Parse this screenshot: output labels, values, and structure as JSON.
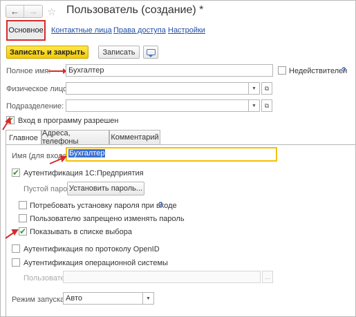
{
  "window": {
    "title": "Пользователь (создание) *",
    "back_icon": "←",
    "forward_icon": "→",
    "favorite_icon": "☆"
  },
  "top_tabs": {
    "active": "Основное",
    "links": [
      "Контактные лица",
      "Права доступа",
      "Настройки"
    ]
  },
  "toolbar": {
    "save_close_label": "Записать и закрыть",
    "save_label": "Записать"
  },
  "fields": {
    "full_name_label": "Полное имя:",
    "full_name_value": "Бухгалтер",
    "inactive_label": "Недействителен",
    "person_label": "Физическое лицо:",
    "department_label": "Подразделение:",
    "login_allowed_label": "Вход в программу разрешен"
  },
  "inner_tabs": [
    "Главное",
    "Адреса, телефоны",
    "Комментарий"
  ],
  "main_tab": {
    "login_name_label": "Имя (для входа):",
    "login_name_value": "Бухгалтер",
    "auth_1c_label": "Аутентификация 1С:Предприятия",
    "empty_password_label": "Пустой пароль",
    "set_password_label": "Установить пароль...",
    "require_password_label": "Потребовать установку пароля при входе",
    "forbid_change_label": "Пользователю запрещено изменять пароль",
    "show_in_list_label": "Показывать в списке выбора",
    "openid_label": "Аутентификация по протоколу OpenID",
    "os_auth_label": "Аутентификация операционной системы",
    "os_user_label": "Пользователь:",
    "launch_mode_label": "Режим запуска:",
    "launch_mode_value": "Авто"
  },
  "checkbox_states": {
    "inactive": false,
    "login_allowed": true,
    "auth_1c": true,
    "require_password": false,
    "forbid_change": false,
    "show_in_list": true,
    "openid": false,
    "os_auth": false
  },
  "colors": {
    "accent_yellow": "#f5c900",
    "highlight_red": "#d62b2b",
    "link_blue": "#1f4ca8",
    "focus_yellow": "#f4c000",
    "check_green": "#3a9a2a"
  },
  "icons": {
    "help": "?",
    "dropdown": "▼",
    "open": "⧉",
    "ellipsis": "..."
  }
}
